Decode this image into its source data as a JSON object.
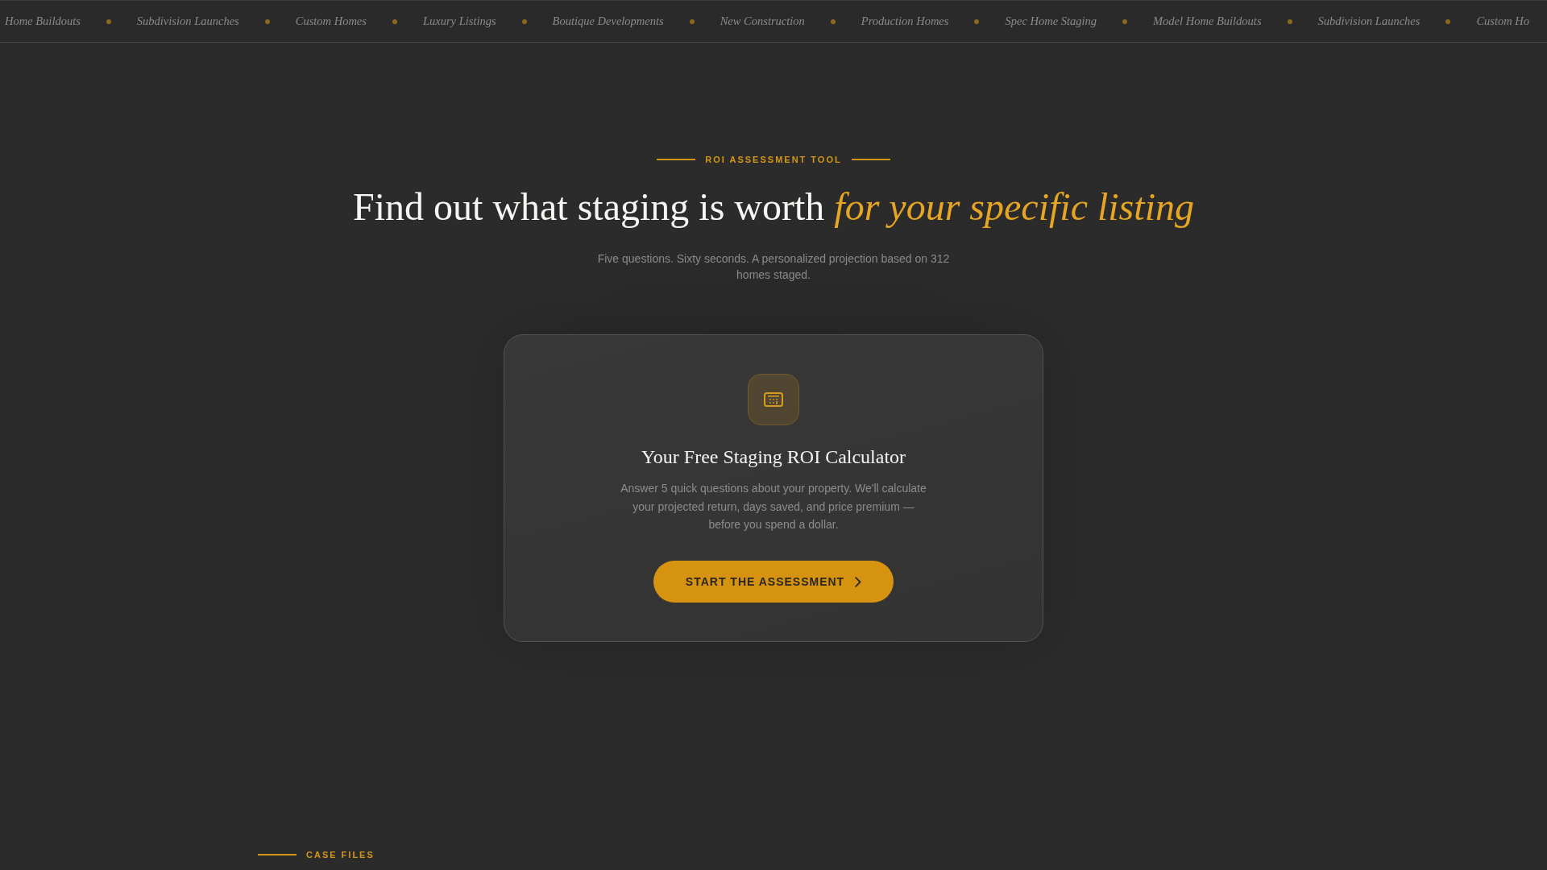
{
  "ticker": {
    "items": [
      "Home Buildouts",
      "Subdivision Launches",
      "Custom Homes",
      "Luxury Listings",
      "Boutique Developments",
      "New Construction",
      "Production Homes",
      "Spec Home Staging",
      "Model Home Buildouts",
      "Subdivision Launches",
      "Custom Ho"
    ]
  },
  "hero": {
    "eyebrow": "ROI ASSESSMENT TOOL",
    "title": "Find out what staging is worth *for your specific listing*",
    "subtitle": "Five questions. Sixty seconds. A personalized projection based on 312 homes staged."
  },
  "card": {
    "title": "Your Free Staging ROI Calculator",
    "text": "Answer 5 quick questions about your property. We'll calculate your projected return, days saved, and price premium — before you spend a dollar.",
    "button": "START THE ASSESSMENT"
  },
  "next_section": {
    "eyebrow": "CASE FILES"
  }
}
